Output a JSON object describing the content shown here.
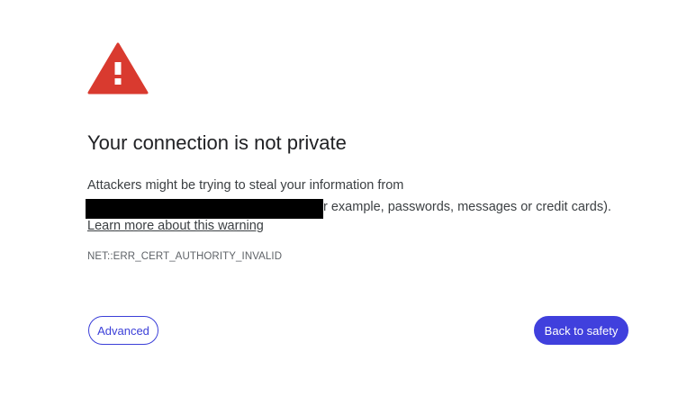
{
  "interstitial": {
    "icon": "warning-triangle-icon",
    "icon_color": "#d93a2f",
    "title": "Your connection is not private",
    "description_line1": "Attackers might be trying to steal your information from",
    "description_line2_visible": "r example, passwords, messages or credit cards).",
    "learn_more": "Learn more about this warning",
    "error_code": "NET::ERR_CERT_AUTHORITY_INVALID"
  },
  "buttons": {
    "advanced_label": "Advanced",
    "back_to_safety_label": "Back to safety"
  },
  "colors": {
    "accent": "#4040dd",
    "warning": "#d93a2f",
    "text": "#202124"
  }
}
